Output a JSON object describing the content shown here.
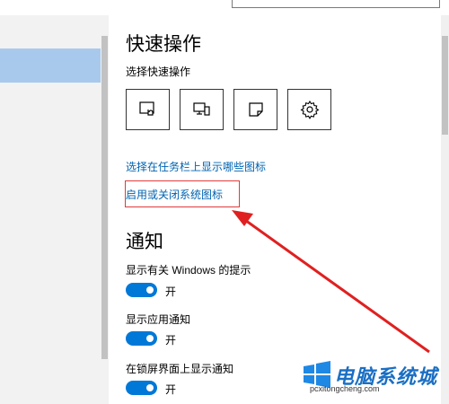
{
  "quick_actions": {
    "heading": "快速操作",
    "subheading": "选择快速操作",
    "tiles": [
      {
        "icon": "tablet-mode-icon"
      },
      {
        "icon": "project-display-icon"
      },
      {
        "icon": "note-icon"
      },
      {
        "icon": "gear-icon"
      }
    ],
    "link_taskbar_icons": "选择在任务栏上显示哪些图标",
    "link_system_icons": "启用或关闭系统图标"
  },
  "notifications": {
    "heading": "通知",
    "settings": [
      {
        "label": "显示有关 Windows 的提示",
        "state": "开",
        "on": true
      },
      {
        "label": "显示应用通知",
        "state": "开",
        "on": true
      },
      {
        "label": "在锁屏界面上显示通知",
        "state": "开",
        "on": true
      }
    ]
  },
  "colors": {
    "accent": "#0078d7",
    "link": "#0063b1",
    "highlight": "#e03a3a",
    "arrow": "#e02020",
    "selected_nav": "#a8c9ec"
  },
  "watermark": {
    "title": "电脑系统城",
    "url": "pcxitongcheng.com"
  }
}
